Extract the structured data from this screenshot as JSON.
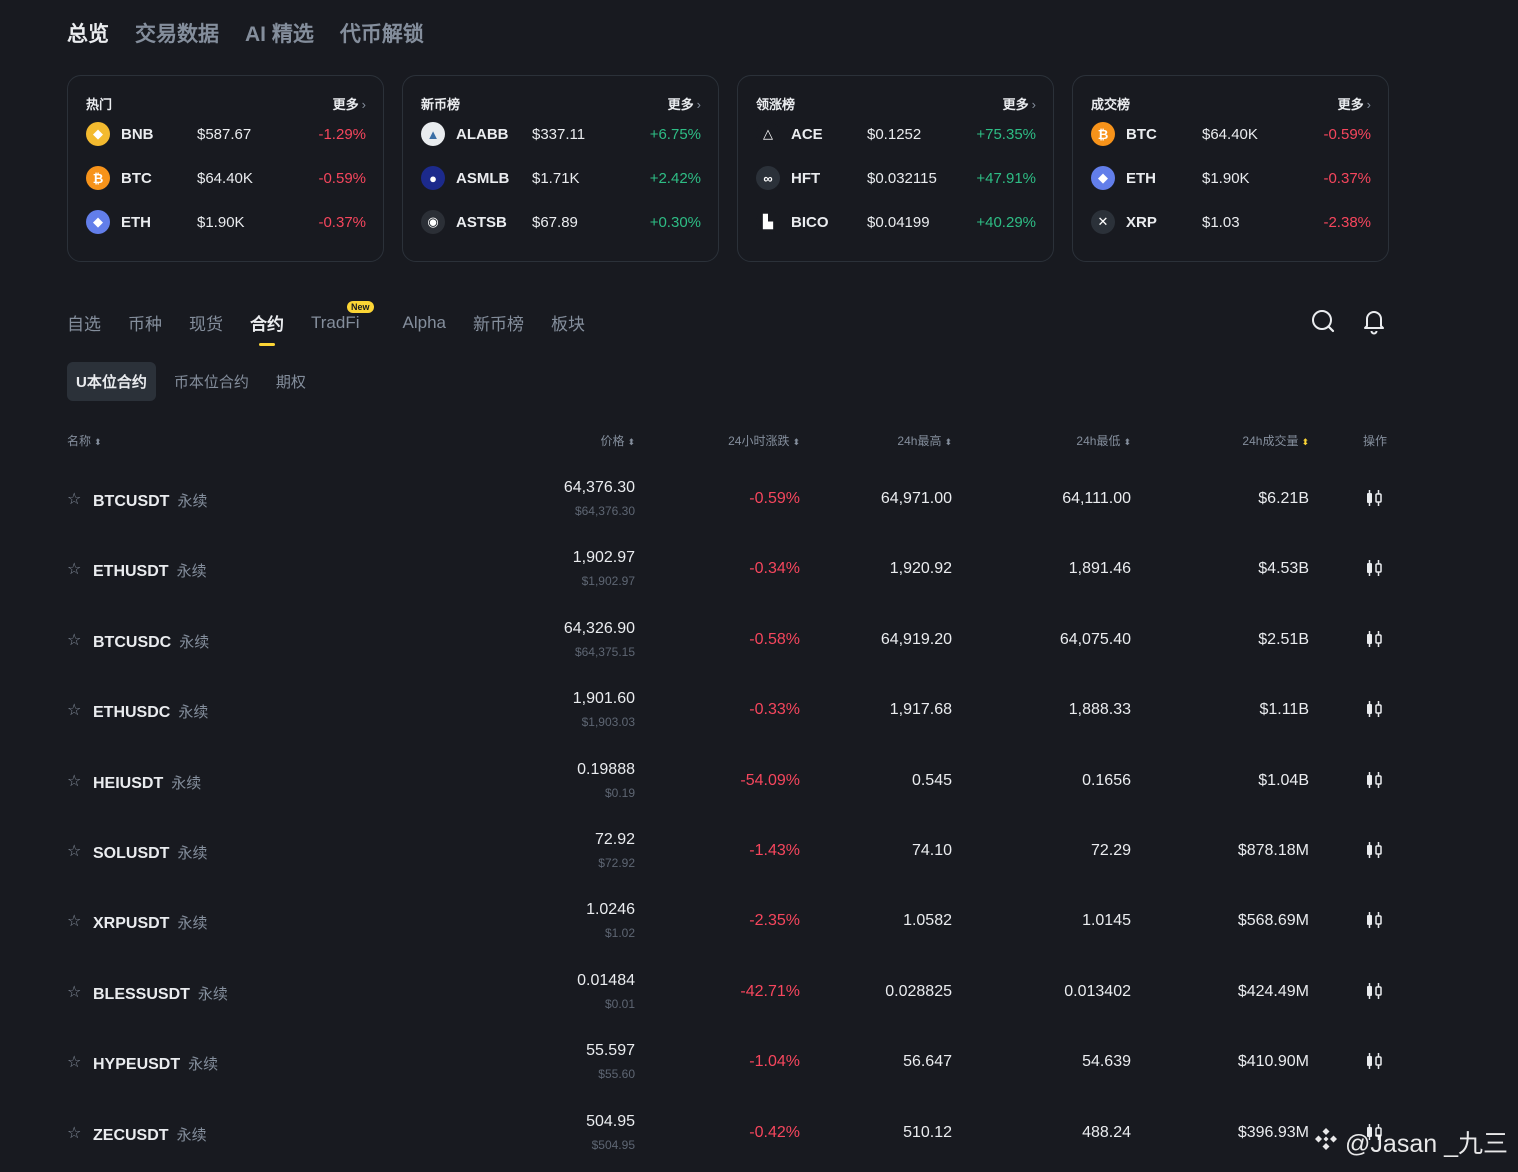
{
  "top_tabs": [
    "总览",
    "交易数据",
    "AI 精选",
    "代币解锁"
  ],
  "cards": [
    {
      "title": "热门",
      "more": "更多",
      "rows": [
        {
          "icon": "bnb-icon",
          "icon_char": "◆",
          "icon_bg": "#f3ba2f",
          "sym": "BNB",
          "price": "$587.67",
          "change": "-1.29%",
          "dir": "down"
        },
        {
          "icon": "btc-icon",
          "icon_char": "₿",
          "icon_bg": "#f7931a",
          "sym": "BTC",
          "price": "$64.40K",
          "change": "-0.59%",
          "dir": "down"
        },
        {
          "icon": "eth-icon",
          "icon_char": "◆",
          "icon_bg": "#627eea",
          "sym": "ETH",
          "price": "$1.90K",
          "change": "-0.37%",
          "dir": "down"
        }
      ]
    },
    {
      "title": "新币榜",
      "more": "更多",
      "rows": [
        {
          "icon": "alabb-icon",
          "icon_char": "▲",
          "icon_bg": "#e9ecef",
          "sym": "ALABB",
          "price": "$337.11",
          "change": "+6.75%",
          "dir": "up"
        },
        {
          "icon": "asmlb-icon",
          "icon_char": "●",
          "icon_bg": "#1c2a8c",
          "sym": "ASMLB",
          "price": "$1.71K",
          "change": "+2.42%",
          "dir": "up"
        },
        {
          "icon": "astsb-icon",
          "icon_char": "◉",
          "icon_bg": "#2b2f36",
          "sym": "ASTSB",
          "price": "$67.89",
          "change": "+0.30%",
          "dir": "up"
        }
      ]
    },
    {
      "title": "领涨榜",
      "more": "更多",
      "rows": [
        {
          "icon": "ace-icon",
          "icon_char": "△",
          "icon_bg": "#181a20",
          "sym": "ACE",
          "price": "$0.1252",
          "change": "+75.35%",
          "dir": "up"
        },
        {
          "icon": "hft-icon",
          "icon_char": "∞",
          "icon_bg": "#2b3139",
          "sym": "HFT",
          "price": "$0.032115",
          "change": "+47.91%",
          "dir": "up"
        },
        {
          "icon": "bico-icon",
          "icon_char": "▙",
          "icon_bg": "#181a20",
          "sym": "BICO",
          "price": "$0.04199",
          "change": "+40.29%",
          "dir": "up"
        }
      ]
    },
    {
      "title": "成交榜",
      "more": "更多",
      "rows": [
        {
          "icon": "btc-icon",
          "icon_char": "₿",
          "icon_bg": "#f7931a",
          "sym": "BTC",
          "price": "$64.40K",
          "change": "-0.59%",
          "dir": "down"
        },
        {
          "icon": "eth-icon",
          "icon_char": "◆",
          "icon_bg": "#627eea",
          "sym": "ETH",
          "price": "$1.90K",
          "change": "-0.37%",
          "dir": "down"
        },
        {
          "icon": "xrp-icon",
          "icon_char": "✕",
          "icon_bg": "#2b3139",
          "sym": "XRP",
          "price": "$1.03",
          "change": "-2.38%",
          "dir": "down"
        }
      ]
    }
  ],
  "market_tabs": [
    "自选",
    "币种",
    "现货",
    "合约",
    "TradFi",
    "Alpha",
    "新币榜",
    "板块"
  ],
  "new_badge": "New",
  "sub_tabs": [
    "U本位合约",
    "币本位合约",
    "期权"
  ],
  "columns": {
    "name": "名称",
    "price": "价格",
    "change": "24小时涨跌",
    "high": "24h最高",
    "low": "24h最低",
    "volume": "24h成交量",
    "action": "操作"
  },
  "sort_glyph": "⬍",
  "perp_label": "永续",
  "rows": [
    {
      "sym": "BTCUSDT",
      "price": "64,376.30",
      "usd": "$64,376.30",
      "change": "-0.59%",
      "high": "64,971.00",
      "low": "64,111.00",
      "volume": "$6.21B"
    },
    {
      "sym": "ETHUSDT",
      "price": "1,902.97",
      "usd": "$1,902.97",
      "change": "-0.34%",
      "high": "1,920.92",
      "low": "1,891.46",
      "volume": "$4.53B"
    },
    {
      "sym": "BTCUSDC",
      "price": "64,326.90",
      "usd": "$64,375.15",
      "change": "-0.58%",
      "high": "64,919.20",
      "low": "64,075.40",
      "volume": "$2.51B"
    },
    {
      "sym": "ETHUSDC",
      "price": "1,901.60",
      "usd": "$1,903.03",
      "change": "-0.33%",
      "high": "1,917.68",
      "low": "1,888.33",
      "volume": "$1.11B"
    },
    {
      "sym": "HEIUSDT",
      "price": "0.19888",
      "usd": "$0.19",
      "change": "-54.09%",
      "high": "0.545",
      "low": "0.1656",
      "volume": "$1.04B"
    },
    {
      "sym": "SOLUSDT",
      "price": "72.92",
      "usd": "$72.92",
      "change": "-1.43%",
      "high": "74.10",
      "low": "72.29",
      "volume": "$878.18M"
    },
    {
      "sym": "XRPUSDT",
      "price": "1.0246",
      "usd": "$1.02",
      "change": "-2.35%",
      "high": "1.0582",
      "low": "1.0145",
      "volume": "$568.69M"
    },
    {
      "sym": "BLESSUSDT",
      "price": "0.01484",
      "usd": "$0.01",
      "change": "-42.71%",
      "high": "0.028825",
      "low": "0.013402",
      "volume": "$424.49M"
    },
    {
      "sym": "HYPEUSDT",
      "price": "55.597",
      "usd": "$55.60",
      "change": "-1.04%",
      "high": "56.647",
      "low": "54.639",
      "volume": "$410.90M"
    },
    {
      "sym": "ZECUSDT",
      "price": "504.95",
      "usd": "$504.95",
      "change": "-0.42%",
      "high": "510.12",
      "low": "488.24",
      "volume": "$396.93M"
    }
  ],
  "watermark": "@Jasan _九三",
  "colors": {
    "up": "#2ebd85",
    "down": "#f6465d",
    "accent": "#fcd535",
    "background": "#181a20"
  }
}
